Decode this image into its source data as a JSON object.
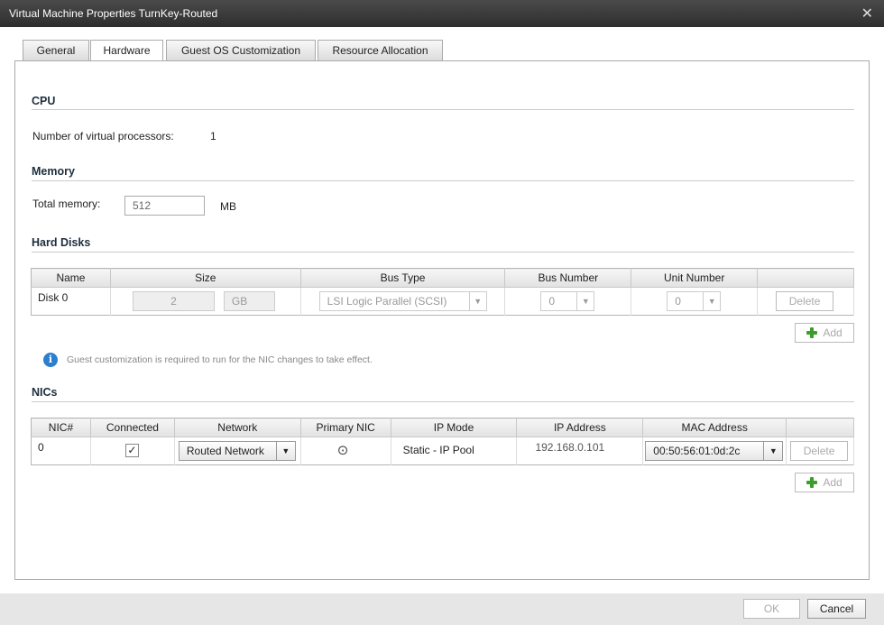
{
  "window": {
    "title": "Virtual Machine Properties TurnKey-Routed"
  },
  "tabs": [
    {
      "label": "General"
    },
    {
      "label": "Hardware"
    },
    {
      "label": "Guest OS Customization"
    },
    {
      "label": "Resource Allocation"
    }
  ],
  "cpu": {
    "title": "CPU",
    "label": "Number of virtual processors:",
    "value": "1"
  },
  "memory": {
    "title": "Memory",
    "label": "Total memory:",
    "value": "512",
    "unit": "MB"
  },
  "disks": {
    "title": "Hard Disks",
    "columns": [
      "Name",
      "Size",
      "Bus Type",
      "Bus Number",
      "Unit Number",
      ""
    ],
    "rows": [
      {
        "name": "Disk 0",
        "size": "2",
        "size_unit": "GB",
        "bus_type": "LSI Logic Parallel (SCSI)",
        "bus_number": "0",
        "unit_number": "0",
        "delete": "Delete"
      }
    ],
    "add_label": "Add"
  },
  "notice": {
    "text": "Guest customization is required to run for the NIC changes to take effect."
  },
  "nics": {
    "title": "NICs",
    "columns": [
      "NIC#",
      "Connected",
      "Network",
      "Primary NIC",
      "IP Mode",
      "IP Address",
      "MAC Address",
      ""
    ],
    "rows": [
      {
        "nic": "0",
        "connected": "✓",
        "network": "Routed Network",
        "primary": "⊙",
        "ip_mode": "Static - IP Pool",
        "ip_address": "192.168.0.101",
        "mac": "00:50:56:01:0d:2c",
        "delete": "Delete"
      }
    ],
    "add_label": "Add"
  },
  "footer": {
    "ok": "OK",
    "cancel": "Cancel"
  },
  "icons": {
    "close": "close-icon",
    "info": "info-icon",
    "add": "plus-icon",
    "dropdown": "chevron-down-icon"
  },
  "colors": {
    "titlebar": "#3a3a3a",
    "info_blue": "#2c7fcf",
    "plus_green": "#3c9c2c"
  }
}
